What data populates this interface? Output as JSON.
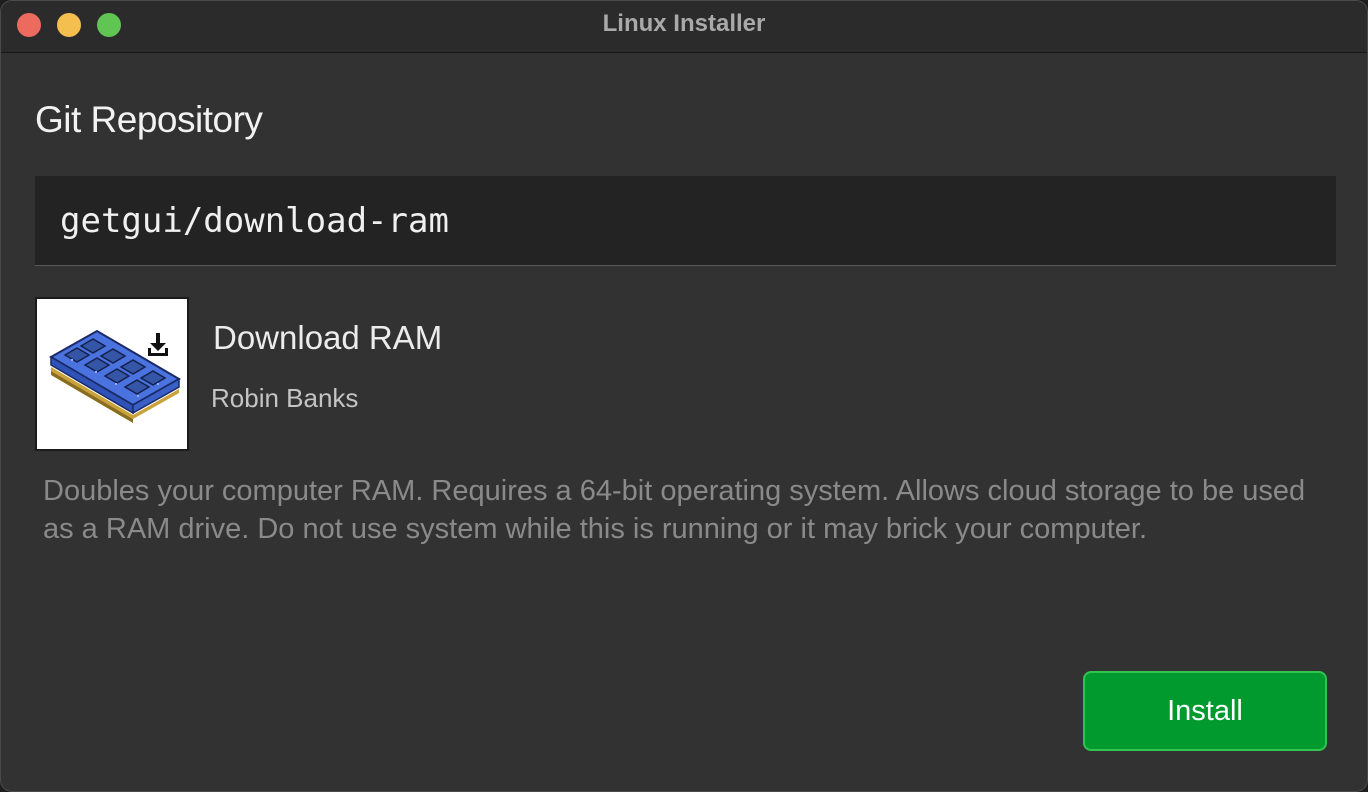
{
  "window": {
    "title": "Linux Installer"
  },
  "repository": {
    "heading": "Git Repository",
    "value": "getgui/download-ram"
  },
  "app": {
    "name": "Download RAM",
    "author": "Robin Banks",
    "thumbnail_icon": "ram-stick-download-icon",
    "description": "Doubles your computer RAM. Requires a 64-bit operating system. Allows cloud storage to be used as a RAM drive. Do not use system while this is running or it may brick your computer."
  },
  "actions": {
    "install_label": "Install"
  },
  "colors": {
    "accent_button": "#009a2e",
    "window_background": "#323232",
    "field_background": "#232323",
    "traffic_close": "#ed6a5e",
    "traffic_minimize": "#f5bf4f",
    "traffic_zoom": "#61c554"
  }
}
